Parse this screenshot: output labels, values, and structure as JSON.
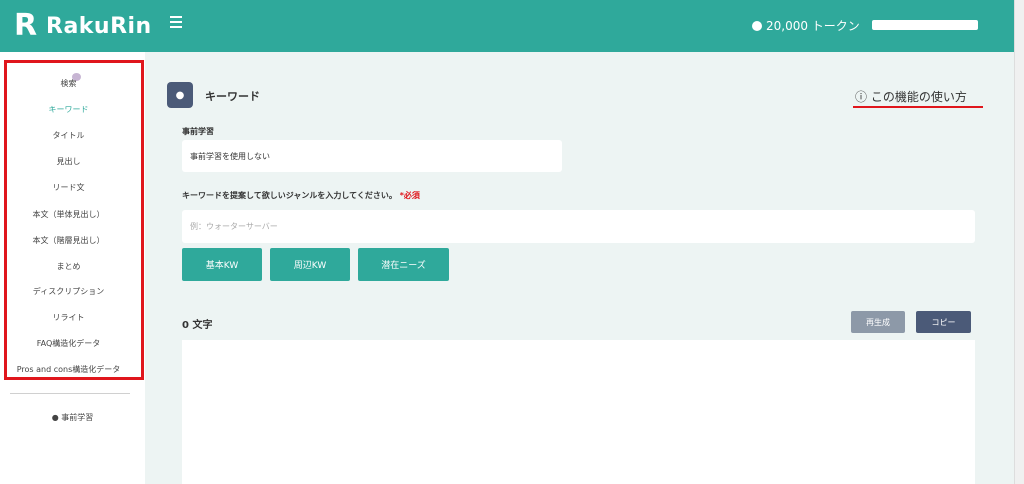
{
  "header": {
    "logo_mark": "R",
    "logo_text": "RakuRin",
    "tokens": "20,000 トークン"
  },
  "sidebar": {
    "items": [
      "検索",
      "キーワード",
      "タイトル",
      "見出し",
      "リード文",
      "本文（単体見出し）",
      "本文（階層見出し）",
      "まとめ",
      "ディスクリプション",
      "リライト",
      "FAQ構造化データ",
      "Pros and cons構造化データ"
    ],
    "active_index": 1,
    "bottom_label": "事前学習"
  },
  "main": {
    "title": "キーワード",
    "help_link": "この機能の使い方",
    "pretraining_label": "事前学習",
    "pretraining_value": "事前学習を使用しない",
    "keyword_label": "キーワードを提案して欲しいジャンルを入力してください。",
    "required": "*必須",
    "keyword_placeholder": "例：ウォーターサーバー",
    "buttons": [
      "基本KW",
      "周辺KW",
      "潜在ニーズ"
    ],
    "char_count": "0 文字",
    "regen_label": "再生成",
    "copy_label": "コピー"
  },
  "colors": {
    "brand": "#2fa99b",
    "highlight": "#e0161c",
    "dark_button": "#4b5a78"
  }
}
